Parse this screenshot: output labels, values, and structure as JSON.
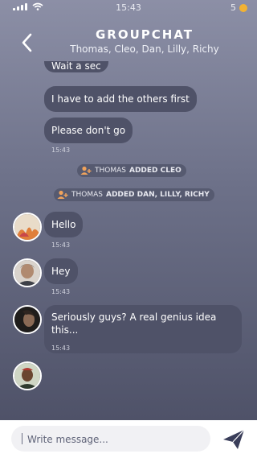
{
  "status_bar": {
    "time": "15:43",
    "notification_count": "5"
  },
  "header": {
    "title": "GROUPCHAT",
    "members": "Thomas, Cleo, Dan, Lilly, Richy"
  },
  "messages": {
    "m1": "Wait a sec",
    "m2": "I have to add the others first",
    "m3": "Please don't go",
    "t3": "15:43",
    "sys1": {
      "actor": "THOMAS",
      "action": "ADDED CLEO"
    },
    "sys2": {
      "actor": "THOMAS",
      "action": "ADDED DAN, LILLY, RICHY"
    },
    "m4": "Hello",
    "t4": "15:43",
    "m5": "Hey",
    "t5": "15:43",
    "m6": "Seriously guys? A real genius idea this...",
    "t6": "15:43"
  },
  "composer": {
    "placeholder": "Write message..."
  },
  "icons": {
    "back": "back-arrow-icon",
    "send": "paper-plane-icon",
    "add_user": "add-user-icon"
  },
  "colors": {
    "bubble": "#4f5268",
    "accent_coin": "#f2b233",
    "send": "#3a3e5a"
  }
}
